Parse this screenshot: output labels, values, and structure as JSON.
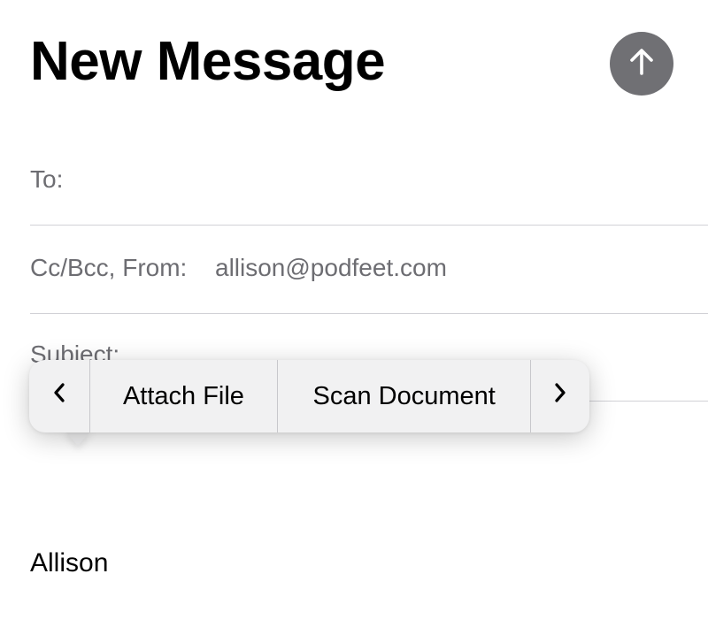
{
  "header": {
    "title": "New Message",
    "send_icon": "arrow-up-icon"
  },
  "fields": {
    "to_label": "To:",
    "cc_from_label": "Cc/Bcc, From:",
    "from_value": "allison@podfeet.com",
    "subject_label": "Subject:"
  },
  "popup_menu": {
    "prev_icon": "chevron-left-icon",
    "items": [
      {
        "label": "Attach File"
      },
      {
        "label": "Scan Document"
      }
    ],
    "next_icon": "chevron-right-icon"
  },
  "body": {
    "signature": "Allison"
  },
  "colors": {
    "send_button": "#707074",
    "label_gray": "#6d6d72",
    "separator": "#d1d1d6",
    "popup_bg": "#f1f1f2"
  }
}
